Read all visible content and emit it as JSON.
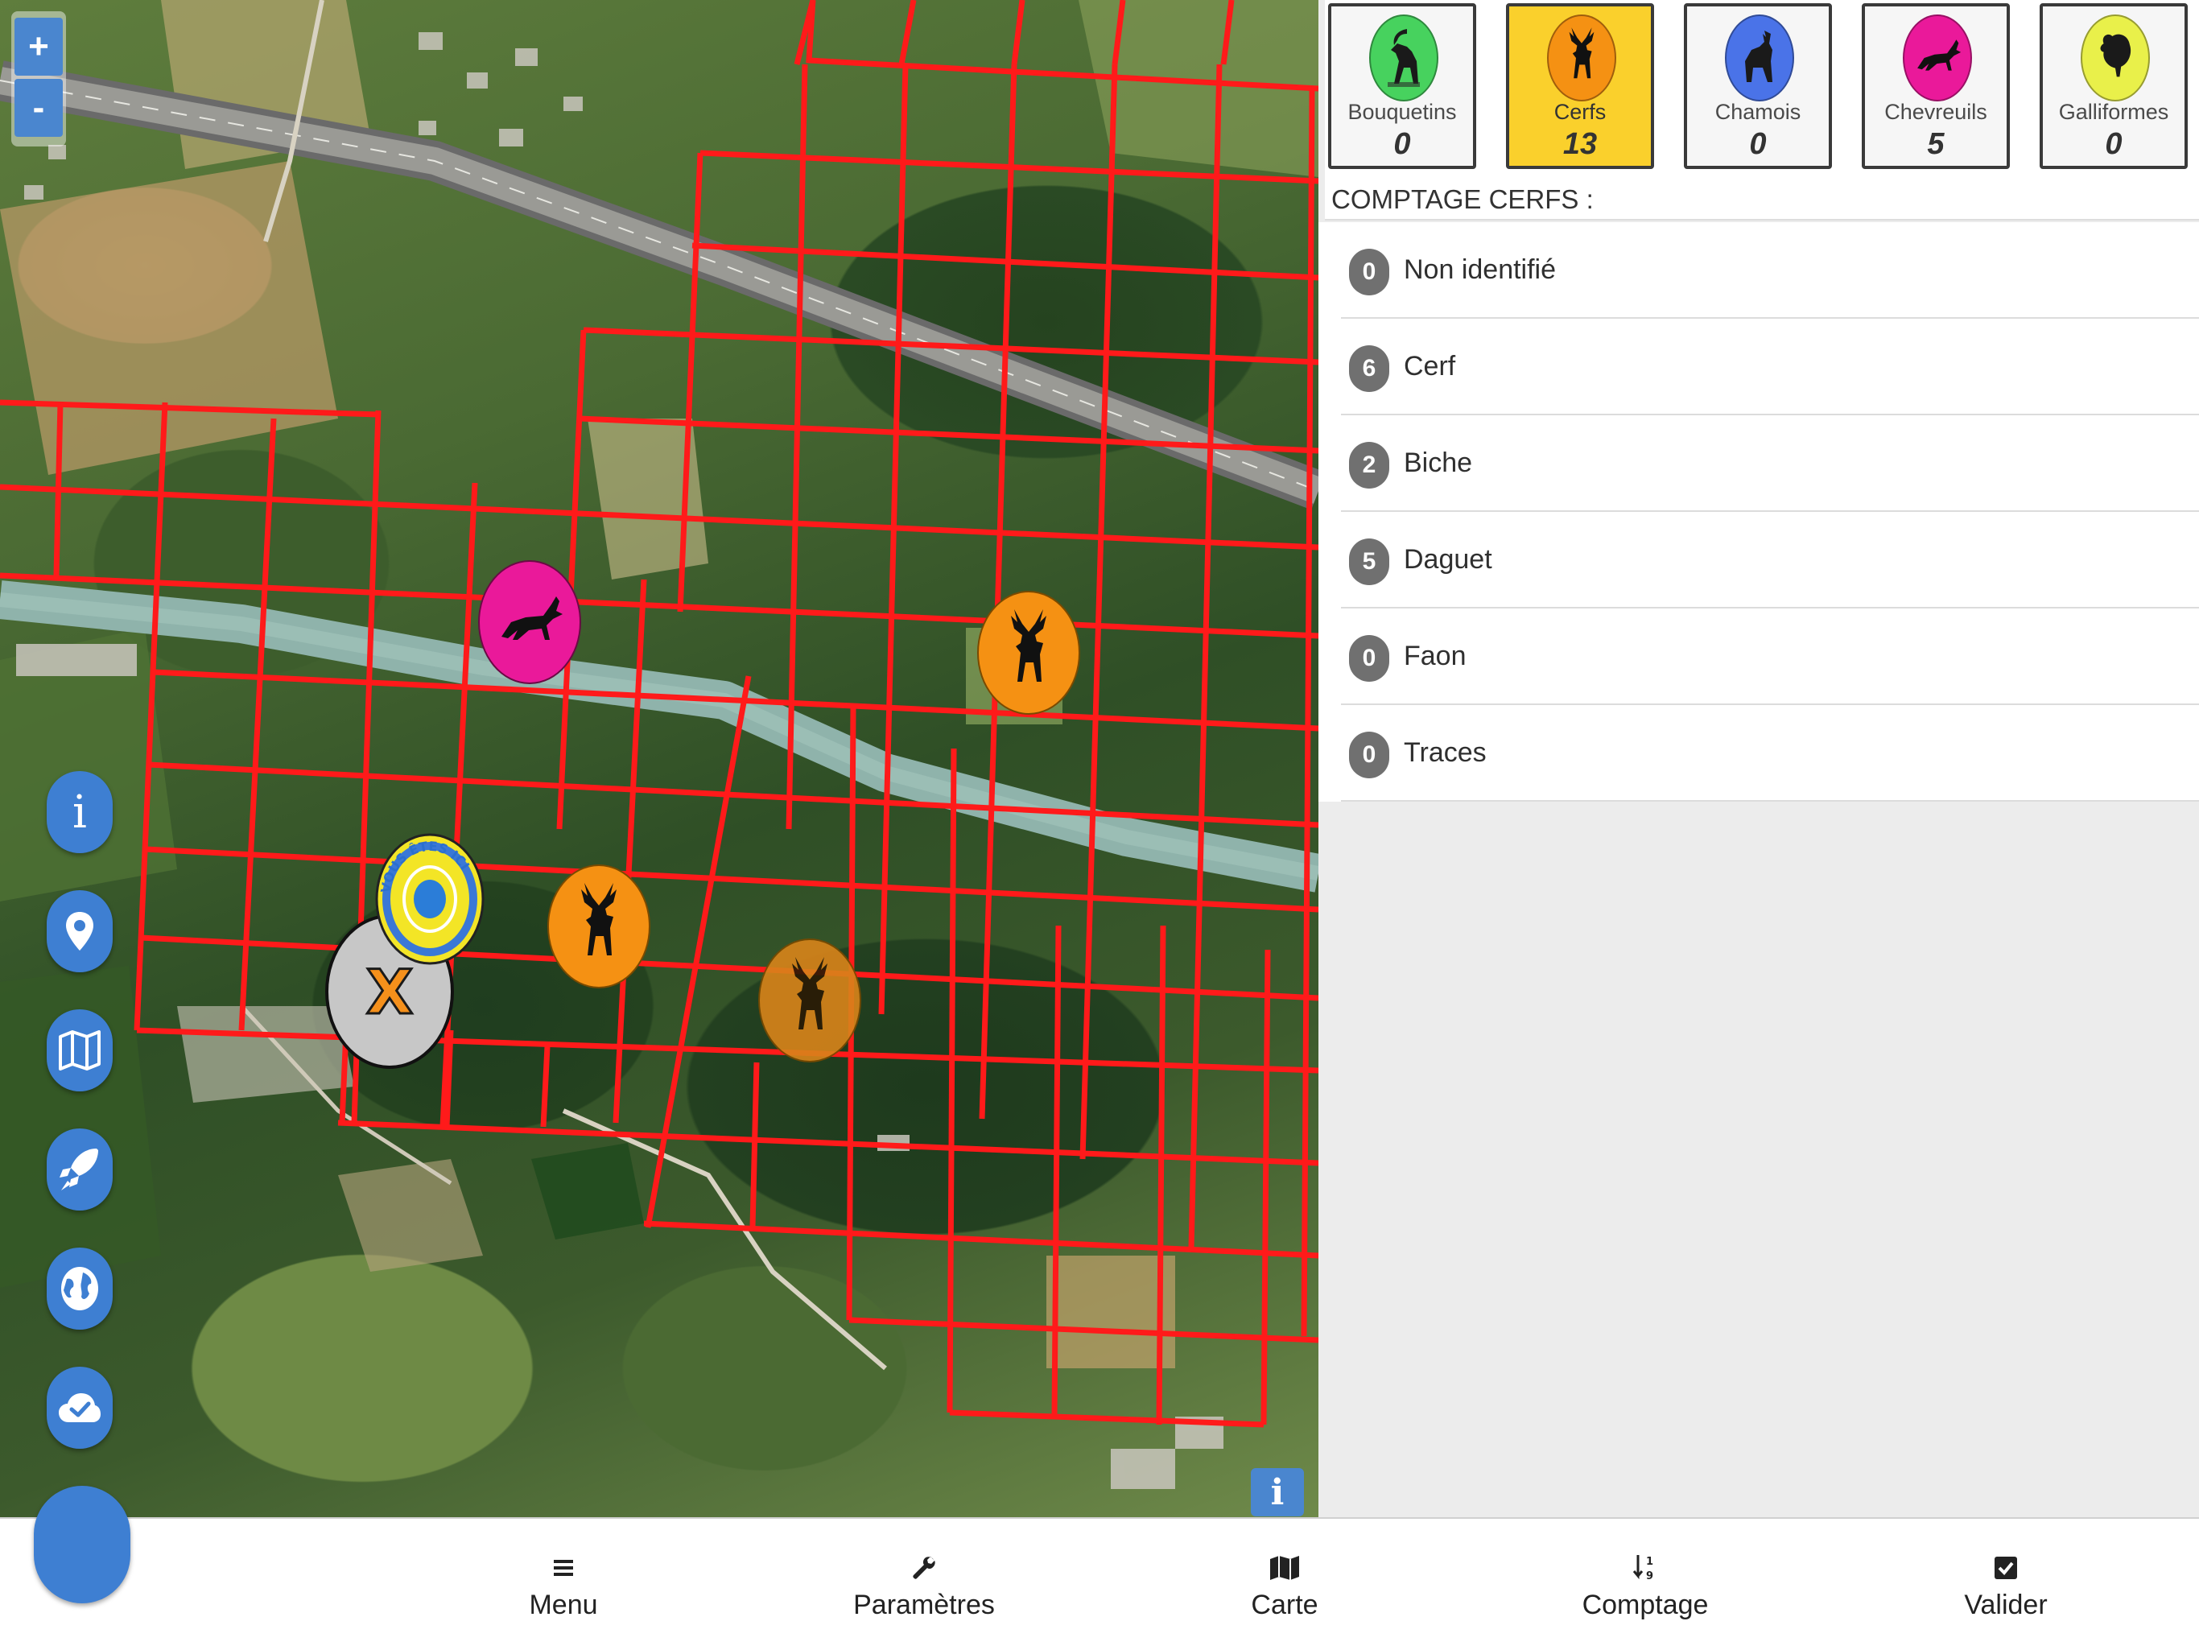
{
  "map": {
    "zoom_in": "+",
    "zoom_out": "-",
    "attribution_info": "i",
    "you_are_here_text": "VOUS ÊTES ICI",
    "remove_marker_label": "X",
    "side_buttons": [
      {
        "name": "info-button",
        "icon": "info-icon",
        "glyph": "i"
      },
      {
        "name": "location-button",
        "icon": "map-pin-icon"
      },
      {
        "name": "map-layers-button",
        "icon": "folded-map-icon"
      },
      {
        "name": "launch-button",
        "icon": "rocket-icon"
      },
      {
        "name": "globe-button",
        "icon": "globe-icon"
      },
      {
        "name": "cloud-sync-button",
        "icon": "cloud-check-icon"
      }
    ],
    "colors": {
      "grid": "#ff1a1a",
      "river": "#8fb3ab",
      "cerf_marker": "#f59113",
      "chevreuil_marker": "#ea199a"
    }
  },
  "species": [
    {
      "name": "Bouquetins",
      "count": "0",
      "color": "#47d25e",
      "icon": "ibex-icon",
      "active": false
    },
    {
      "name": "Cerfs",
      "count": "13",
      "color": "#f59113",
      "icon": "deer-icon",
      "active": true
    },
    {
      "name": "Chamois",
      "count": "0",
      "color": "#4a73e8",
      "icon": "chamois-icon",
      "active": false
    },
    {
      "name": "Chevreuils",
      "count": "5",
      "color": "#ea199a",
      "icon": "roe-deer-icon",
      "active": false
    },
    {
      "name": "Galliformes",
      "count": "0",
      "color": "#e9f04a",
      "icon": "grouse-icon",
      "active": false
    }
  ],
  "comptage": {
    "title": "COMPTAGE CERFS :",
    "items": [
      {
        "count": "0",
        "label": "Non identifié"
      },
      {
        "count": "6",
        "label": "Cerf"
      },
      {
        "count": "2",
        "label": "Biche"
      },
      {
        "count": "5",
        "label": "Daguet"
      },
      {
        "count": "0",
        "label": "Faon"
      },
      {
        "count": "0",
        "label": "Traces"
      }
    ]
  },
  "bottom_nav": [
    {
      "label": "Menu",
      "icon": "hamburger-icon"
    },
    {
      "label": "Paramètres",
      "icon": "wrench-icon"
    },
    {
      "label": "Carte",
      "icon": "map-icon"
    },
    {
      "label": "Comptage",
      "icon": "sort-numeric-icon"
    },
    {
      "label": "Valider",
      "icon": "checkbox-icon"
    }
  ]
}
